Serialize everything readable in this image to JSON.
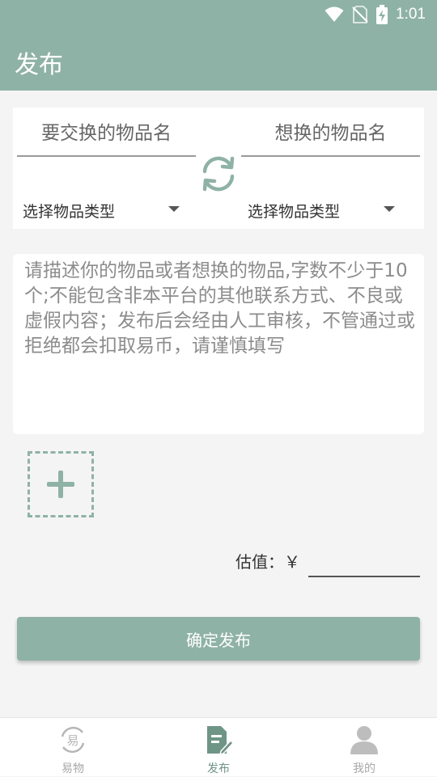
{
  "status_bar": {
    "time": "1:01",
    "icons": [
      "wifi-icon",
      "no-sim-icon",
      "battery-charging-icon"
    ]
  },
  "app_bar": {
    "title": "发布"
  },
  "swap": {
    "own_item_placeholder": "要交换的物品名",
    "wanted_item_placeholder": "想换的物品名",
    "own_type_label": "选择物品类型",
    "wanted_type_label": "选择物品类型",
    "swap_icon": "swap-arrows-icon"
  },
  "description": {
    "placeholder": "请描述你的物品或者想换的物品,字数不少于10个;不能包含非本平台的其他联系方式、不良或虚假内容；发布后会经由人工审核，不管通过或拒绝都会扣取易币，请谨慎填写"
  },
  "image_upload": {
    "icon": "add-image-icon"
  },
  "valuation": {
    "label": "估值：￥",
    "value": ""
  },
  "submit": {
    "label": "确定发布"
  },
  "bottom_nav": {
    "items": [
      {
        "label": "易物",
        "icon": "exchange-icon",
        "active": false
      },
      {
        "label": "发布",
        "icon": "publish-icon",
        "active": true
      },
      {
        "label": "我的",
        "icon": "profile-icon",
        "active": false
      }
    ]
  },
  "colors": {
    "primary": "#8fb2a6",
    "active_nav": "#6f9587",
    "inactive_nav": "#a8a8a8",
    "background": "#f4f4f4"
  }
}
